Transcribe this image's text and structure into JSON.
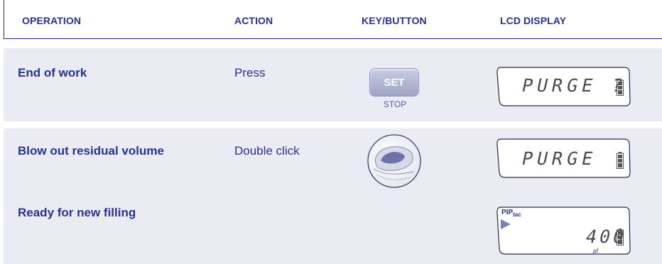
{
  "header": {
    "operation": "OPERATION",
    "action": "ACTION",
    "key_button": "KEY/BUTTON",
    "lcd_display": "LCD DISPLAY"
  },
  "rows": [
    {
      "operation": "End of work",
      "action": "Press",
      "button_label": "SET",
      "button_sublabel": "STOP",
      "lcd_text": "PURGE ?"
    },
    {
      "operation": "Blow out residual volume",
      "action": "Double click",
      "lcd_text": "PURGE"
    },
    {
      "operation": "Ready for new filling",
      "action": "",
      "lcd_logo": "PIP",
      "lcd_logo_sub": "tac",
      "lcd_text": "400",
      "lcd_unit": "µl"
    }
  ],
  "colors": {
    "accent": "#2b3190",
    "panel": "#ebebf3",
    "button": "#9ea4c6"
  },
  "icons": [
    "battery-icon",
    "play-arrow-icon",
    "pipette-button-icon"
  ]
}
